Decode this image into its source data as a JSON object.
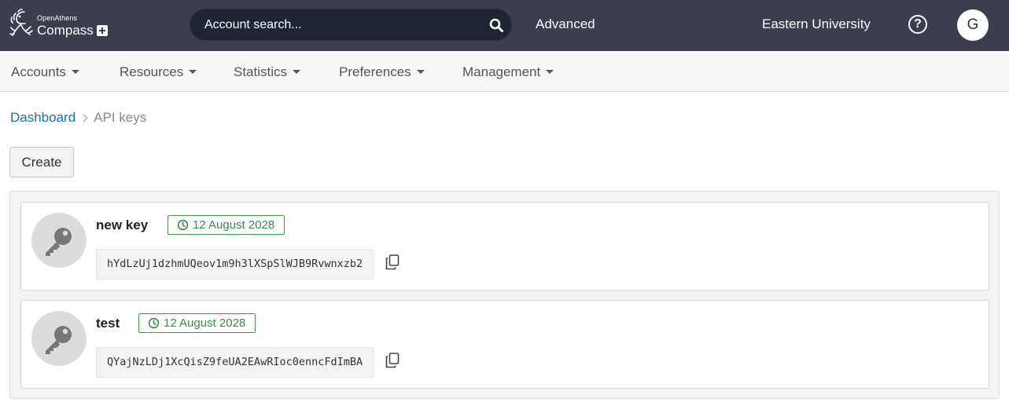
{
  "header": {
    "logo_small": "OpenAthens",
    "logo_big": "Compass",
    "search_placeholder": "Account search...",
    "advanced_label": "Advanced",
    "organization": "Eastern University",
    "help_icon": "?",
    "avatar_initial": "G"
  },
  "nav": {
    "items": [
      {
        "label": "Accounts"
      },
      {
        "label": "Resources"
      },
      {
        "label": "Statistics"
      },
      {
        "label": "Preferences"
      },
      {
        "label": "Management"
      }
    ]
  },
  "breadcrumb": {
    "home": "Dashboard",
    "current": "API keys"
  },
  "actions": {
    "create_label": "Create"
  },
  "api_keys": [
    {
      "name": "new key",
      "expiry": "12 August 2028",
      "key": "hYdLzUj1dzhmUQeov1m9h3lXSpSlWJB9Rvwnxzb2"
    },
    {
      "name": "test",
      "expiry": "12 August 2028",
      "key": "QYajNzLDj1XcQisZ9feUA2EAwRIoc0enncFdImBA"
    }
  ],
  "colors": {
    "topbar": "#3c3d4d",
    "search_bg": "#1d2433",
    "link": "#1f6fa6",
    "expiry_green": "#3f8a48"
  },
  "icons": [
    "logo-icon",
    "search-icon",
    "help-icon",
    "caret-down-icon",
    "chevron-right-icon",
    "key-icon",
    "clock-icon",
    "copy-icon"
  ]
}
